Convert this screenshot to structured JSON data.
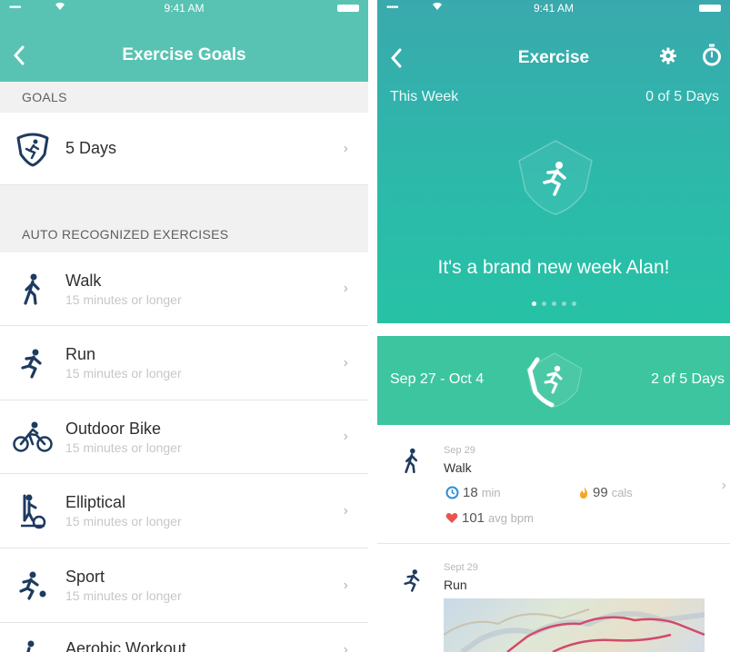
{
  "left": {
    "status": {
      "signal": "•••••",
      "time": "9:41 AM"
    },
    "header": {
      "title": "Exercise Goals"
    },
    "goals_section": {
      "label": "GOALS"
    },
    "goal": {
      "label": "5 Days"
    },
    "auto_section": {
      "label": "AUTO RECOGNIZED EXERCISES"
    },
    "exercises": [
      {
        "name": "Walk",
        "sub": "15 minutes or longer",
        "icon": "walk-icon"
      },
      {
        "name": "Run",
        "sub": "15 minutes or longer",
        "icon": "run-icon"
      },
      {
        "name": "Outdoor Bike",
        "sub": "15 minutes or longer",
        "icon": "bike-icon"
      },
      {
        "name": "Elliptical",
        "sub": "15 minutes or longer",
        "icon": "elliptical-icon"
      },
      {
        "name": "Sport",
        "sub": "15 minutes or longer",
        "icon": "sport-icon"
      },
      {
        "name": "Aerobic Workout",
        "sub": "",
        "icon": "aerobic-icon"
      }
    ]
  },
  "right": {
    "status": {
      "signal": "•••••",
      "time": "9:41 AM"
    },
    "header": {
      "title": "Exercise"
    },
    "this_week": {
      "label": "This Week",
      "progress": "0 of 5 Days"
    },
    "hero_message": "It's a brand new week Alan!",
    "pager": {
      "count": 5,
      "active": 0
    },
    "past_week": {
      "range": "Sep 27 - Oct 4",
      "progress": "2 of 5 Days"
    },
    "entries": [
      {
        "date": "Sep 29",
        "title": "Walk",
        "minutes": "18",
        "minutes_unit": "min",
        "cals": "99",
        "cals_unit": "cals",
        "bpm": "101",
        "bpm_unit": "avg bpm"
      },
      {
        "date": "Sept 29",
        "title": "Run"
      }
    ]
  },
  "colors": {
    "teal": "#58c3b3",
    "navy": "#1e3a5f",
    "green_band": "#3cc59f",
    "heart": "#e8534f",
    "flame": "#f5a623",
    "clock": "#2f8fd8"
  }
}
